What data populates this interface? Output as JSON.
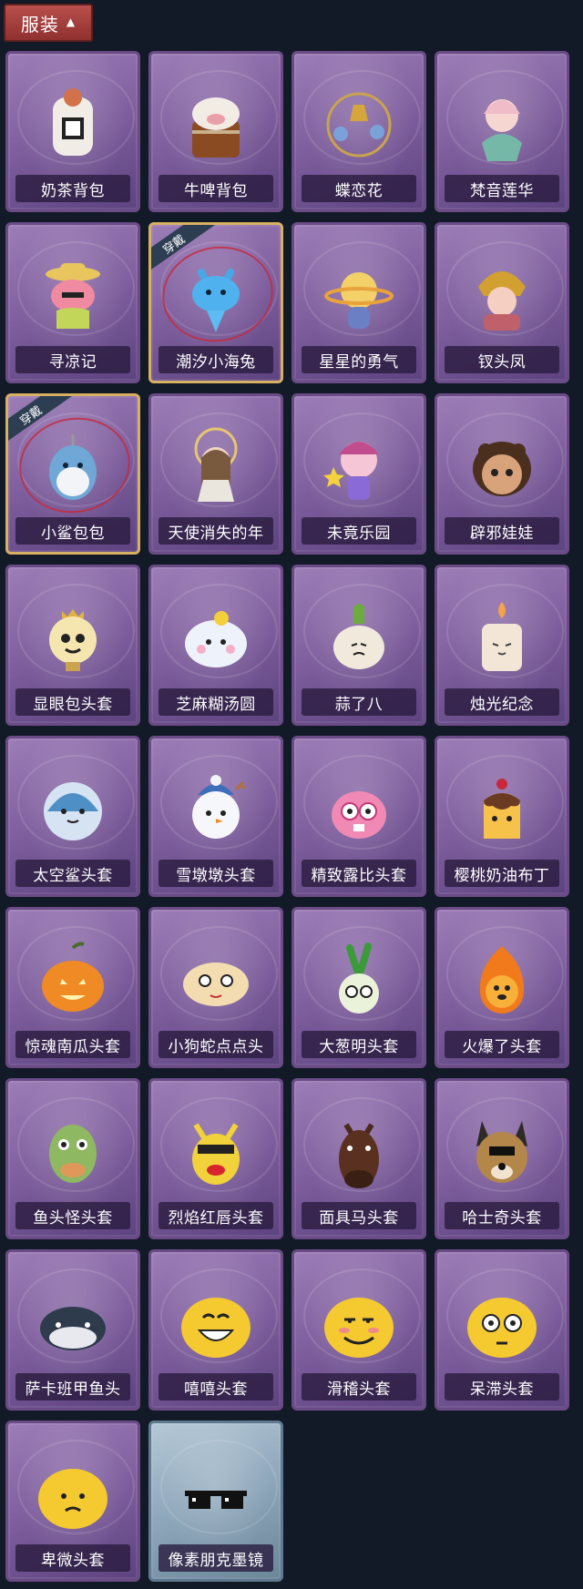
{
  "header": {
    "title": "服装",
    "chevron_icon": "chevron-up-icon"
  },
  "items": [
    {
      "label": "奶茶背包",
      "icon": "milk-tea-backpack",
      "worn": false
    },
    {
      "label": "牛啤背包",
      "icon": "cow-beer-backpack",
      "worn": false
    },
    {
      "label": "蝶恋花",
      "icon": "butterfly-flower-bell",
      "worn": false
    },
    {
      "label": "梵音莲华",
      "icon": "lotus-fairy",
      "worn": false
    },
    {
      "label": "寻凉记",
      "icon": "pink-creature-sunhat",
      "worn": false
    },
    {
      "label": "潮汐小海兔",
      "icon": "blue-sea-bunny",
      "worn": true
    },
    {
      "label": "星星的勇气",
      "icon": "star-planet-doll",
      "worn": false
    },
    {
      "label": "钗头凤",
      "icon": "phoenix-crown",
      "worn": false
    },
    {
      "label": "小鲨包包",
      "icon": "shark-bag",
      "worn": true
    },
    {
      "label": "天使消失的年",
      "icon": "angel-doll",
      "worn": false
    },
    {
      "label": "未竟乐园",
      "icon": "star-girl-doll",
      "worn": false
    },
    {
      "label": "辟邪娃娃",
      "icon": "talisman-doll",
      "worn": false
    },
    {
      "label": "显眼包头套",
      "icon": "lightbulb-head",
      "worn": false
    },
    {
      "label": "芝麻糊汤圆",
      "icon": "rice-ball-head",
      "worn": false
    },
    {
      "label": "蒜了八",
      "icon": "garlic-head",
      "worn": false
    },
    {
      "label": "烛光纪念",
      "icon": "candle-head",
      "worn": false
    },
    {
      "label": "太空鲨头套",
      "icon": "space-shark-head",
      "worn": false
    },
    {
      "label": "雪墩墩头套",
      "icon": "snowman-head",
      "worn": false
    },
    {
      "label": "精致露比头套",
      "icon": "pink-beaver-head",
      "worn": false
    },
    {
      "label": "樱桃奶油布丁",
      "icon": "pudding-head",
      "worn": false
    },
    {
      "label": "惊魂南瓜头套",
      "icon": "pumpkin-head",
      "worn": false
    },
    {
      "label": "小狗蛇点点头",
      "icon": "dog-snake-head",
      "worn": false
    },
    {
      "label": "大葱明头套",
      "icon": "scallion-head",
      "worn": false
    },
    {
      "label": "火爆了头套",
      "icon": "fire-head",
      "worn": false
    },
    {
      "label": "鱼头怪头套",
      "icon": "fish-head",
      "worn": false
    },
    {
      "label": "烈焰红唇头套",
      "icon": "red-lips-head",
      "worn": false
    },
    {
      "label": "面具马头套",
      "icon": "horse-mask-head",
      "worn": false
    },
    {
      "label": "哈士奇头套",
      "icon": "husky-head",
      "worn": false
    },
    {
      "label": "萨卡班甲鱼头",
      "icon": "fish-fossil-head",
      "worn": false
    },
    {
      "label": "嘻嘻头套",
      "icon": "grin-emoji-head",
      "worn": false
    },
    {
      "label": "滑稽头套",
      "icon": "funny-emoji-head",
      "worn": false
    },
    {
      "label": "呆滞头套",
      "icon": "dazed-emoji-head",
      "worn": false
    },
    {
      "label": "卑微头套",
      "icon": "humble-emoji-head",
      "worn": false
    },
    {
      "label": "像素朋克墨镜",
      "icon": "pixel-sunglasses",
      "worn": false
    }
  ],
  "worn_badge": "穿戴",
  "colors": {
    "header_bg": "#a8403e",
    "card_purple": "#7b5b9a",
    "card_blue": "#8aa3b7",
    "worn_border": "#d8b062",
    "background": "#121a27"
  }
}
